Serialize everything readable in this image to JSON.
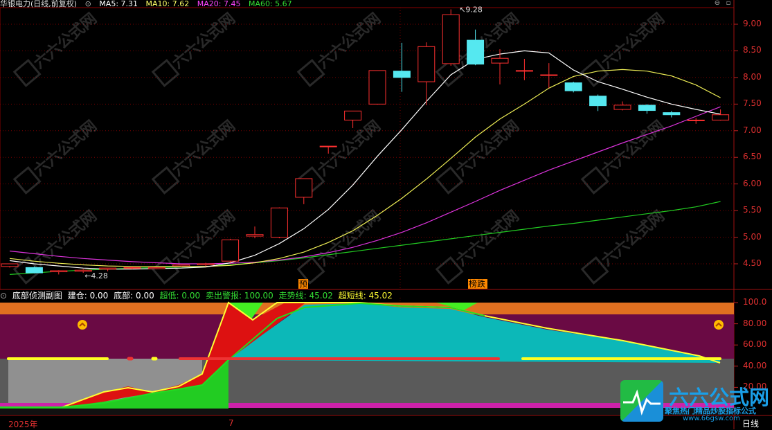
{
  "header": {
    "title": "华银电力(日线,前复权)",
    "ma": [
      {
        "label": "MA5: 7.31",
        "color": "#ffffff"
      },
      {
        "label": "MA10: 7.62",
        "color": "#ffff66"
      },
      {
        "label": "MA20: 7.45",
        "color": "#ff44ff"
      },
      {
        "label": "MA60: 5.67",
        "color": "#33dd33"
      }
    ]
  },
  "price_axis": [
    "9.00",
    "8.50",
    "8.00",
    "7.50",
    "7.00",
    "6.50",
    "6.00",
    "5.50",
    "5.00",
    "4.50"
  ],
  "annotations": {
    "high": "9.28",
    "low": "4.28",
    "tag_yu": "预",
    "tag_die": "榜跌"
  },
  "sub_header": {
    "title": "底部侦测副图",
    "items": [
      {
        "label": "建仓: 0.00",
        "color": "#ffffff"
      },
      {
        "label": "底部: 0.00",
        "color": "#ffffff"
      },
      {
        "label": "超低: 0.00",
        "color": "#33dd33"
      },
      {
        "label": "卖出警报: 100.00",
        "color": "#33dd33"
      },
      {
        "label": "走势线: 45.02",
        "color": "#33dd33"
      },
      {
        "label": "超短线: 45.02",
        "color": "#ffff33"
      }
    ]
  },
  "sub_axis": [
    "100.0",
    "80.00",
    "60.00",
    "40.00",
    "20.00"
  ],
  "bottom": {
    "year": "2025年",
    "month": "7",
    "period": "日线"
  },
  "logo": {
    "name": "六六公式网",
    "slogan": "聚焦热门精品炒股指标公式",
    "url": "www.66gsw.com"
  },
  "watermark": "六六公式网",
  "chart_data": {
    "type": "candlestick",
    "price_range": [
      4.2,
      9.4
    ],
    "candles": [
      {
        "o": 4.45,
        "h": 4.5,
        "l": 4.43,
        "c": 4.5
      },
      {
        "o": 4.43,
        "h": 4.45,
        "l": 4.32,
        "c": 4.33
      },
      {
        "o": 4.35,
        "h": 4.38,
        "l": 4.3,
        "c": 4.37
      },
      {
        "o": 4.36,
        "h": 4.4,
        "l": 4.33,
        "c": 4.38
      },
      {
        "o": 4.4,
        "h": 4.42,
        "l": 4.36,
        "c": 4.42
      },
      {
        "o": 4.42,
        "h": 4.45,
        "l": 4.4,
        "c": 4.43
      },
      {
        "o": 4.41,
        "h": 4.44,
        "l": 4.4,
        "c": 4.43
      },
      {
        "o": 4.46,
        "h": 4.48,
        "l": 4.44,
        "c": 4.48
      },
      {
        "o": 4.48,
        "h": 4.52,
        "l": 4.45,
        "c": 4.5
      },
      {
        "o": 4.55,
        "h": 4.97,
        "l": 4.52,
        "c": 4.95
      },
      {
        "o": 5.02,
        "h": 5.2,
        "l": 4.98,
        "c": 5.05
      },
      {
        "o": 5.0,
        "h": 5.56,
        "l": 4.98,
        "c": 5.55
      },
      {
        "o": 5.75,
        "h": 6.1,
        "l": 5.62,
        "c": 6.1
      },
      {
        "o": 6.71,
        "h": 6.71,
        "l": 6.57,
        "c": 6.71
      },
      {
        "o": 7.2,
        "h": 7.37,
        "l": 7.05,
        "c": 7.37
      },
      {
        "o": 7.5,
        "h": 8.13,
        "l": 7.49,
        "c": 8.13
      },
      {
        "o": 8.12,
        "h": 8.65,
        "l": 7.73,
        "c": 8.0
      },
      {
        "o": 7.92,
        "h": 8.66,
        "l": 7.48,
        "c": 8.58
      },
      {
        "o": 8.26,
        "h": 9.28,
        "l": 8.22,
        "c": 9.18
      },
      {
        "o": 8.7,
        "h": 8.9,
        "l": 8.23,
        "c": 8.25
      },
      {
        "o": 8.27,
        "h": 8.53,
        "l": 7.87,
        "c": 8.36
      },
      {
        "o": 8.13,
        "h": 8.35,
        "l": 7.95,
        "c": 8.13
      },
      {
        "o": 8.05,
        "h": 8.27,
        "l": 7.8,
        "c": 8.05
      },
      {
        "o": 7.9,
        "h": 7.92,
        "l": 7.72,
        "c": 7.75
      },
      {
        "o": 7.65,
        "h": 7.68,
        "l": 7.37,
        "c": 7.47
      },
      {
        "o": 7.4,
        "h": 7.55,
        "l": 7.38,
        "c": 7.48
      },
      {
        "o": 7.48,
        "h": 7.5,
        "l": 7.32,
        "c": 7.38
      },
      {
        "o": 7.34,
        "h": 7.37,
        "l": 7.25,
        "c": 7.3
      },
      {
        "o": 7.2,
        "h": 7.24,
        "l": 7.13,
        "c": 7.2
      },
      {
        "o": 7.2,
        "h": 7.4,
        "l": 7.19,
        "c": 7.3
      }
    ],
    "ma5": [
      4.56,
      4.5,
      4.46,
      4.42,
      4.4,
      4.4,
      4.41,
      4.42,
      4.44,
      4.52,
      4.66,
      4.88,
      5.16,
      5.52,
      5.98,
      6.52,
      7.02,
      7.55,
      8.05,
      8.34,
      8.44,
      8.5,
      8.46,
      8.14,
      7.92,
      7.78,
      7.63,
      7.5,
      7.4,
      7.31
    ],
    "ma10": [
      4.6,
      4.55,
      4.51,
      4.48,
      4.46,
      4.45,
      4.45,
      4.45,
      4.45,
      4.47,
      4.52,
      4.6,
      4.72,
      4.9,
      5.12,
      5.41,
      5.73,
      6.09,
      6.48,
      6.88,
      7.22,
      7.5,
      7.8,
      8.02,
      8.12,
      8.15,
      8.12,
      8.03,
      7.86,
      7.62
    ],
    "ma20": [
      4.74,
      4.69,
      4.64,
      4.6,
      4.57,
      4.54,
      4.52,
      4.5,
      4.5,
      4.51,
      4.53,
      4.57,
      4.63,
      4.71,
      4.81,
      4.94,
      5.09,
      5.27,
      5.47,
      5.67,
      5.88,
      6.07,
      6.26,
      6.43,
      6.6,
      6.77,
      6.93,
      7.09,
      7.27,
      7.45
    ],
    "ma60": [
      4.3,
      4.33,
      4.36,
      4.38,
      4.4,
      4.42,
      4.43,
      4.44,
      4.45,
      4.48,
      4.52,
      4.56,
      4.61,
      4.67,
      4.73,
      4.79,
      4.85,
      4.91,
      4.97,
      5.03,
      5.09,
      5.15,
      5.21,
      5.26,
      5.32,
      5.38,
      5.44,
      5.5,
      5.57,
      5.67
    ]
  }
}
